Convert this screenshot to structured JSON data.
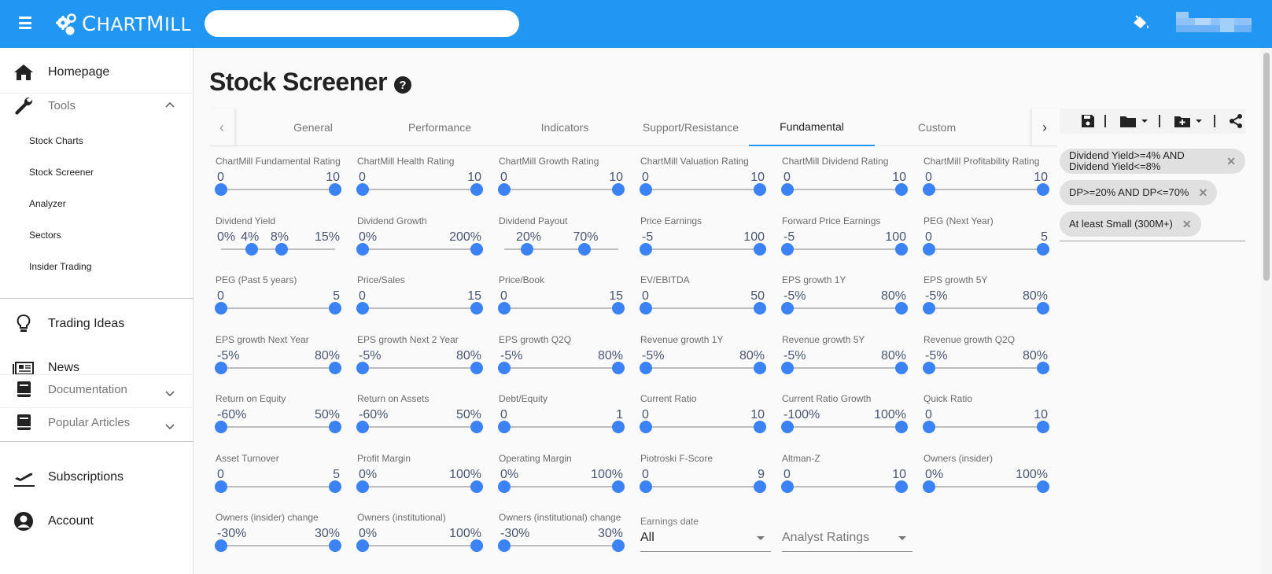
{
  "header": {
    "logo_text": "ChartMill",
    "search_placeholder": "",
    "paint_icon": "paint-bucket-icon",
    "user_name_blurred": true,
    "brand_color": "#2196f3"
  },
  "sidebar": {
    "main_items": [
      {
        "label": "Homepage",
        "icon": "home-icon"
      },
      {
        "label": "Tools",
        "icon": "wrench-icon",
        "expanded": true
      },
      {
        "label": "Trading Ideas",
        "icon": "lightbulb-icon"
      },
      {
        "label": "News",
        "icon": "newspaper-icon"
      },
      {
        "label": "Documentation",
        "icon": "book-icon",
        "expanded": false
      },
      {
        "label": "Popular Articles",
        "icon": "book-icon",
        "expanded": false
      },
      {
        "label": "Subscriptions",
        "icon": "plane-icon"
      },
      {
        "label": "Account",
        "icon": "account-icon"
      }
    ],
    "tools_subitems": [
      "Stock Charts",
      "Stock Screener",
      "Analyzer",
      "Sectors",
      "Insider Trading"
    ]
  },
  "page": {
    "title": "Stock Screener",
    "help_icon": "help-icon"
  },
  "tabs": {
    "items": [
      "General",
      "Performance",
      "Indicators",
      "Support/Resistance",
      "Fundamental",
      "Custom"
    ],
    "active": "Fundamental"
  },
  "toolbar": {
    "save": "save-icon",
    "open": "folder-icon",
    "new": "folder-plus-icon",
    "share": "share-icon"
  },
  "active_filters": [
    "Dividend Yield>=4% AND Dividend Yield<=8%",
    "DP>=20% AND DP<=70%",
    "At least Small (300M+)"
  ],
  "filters": [
    {
      "label": "ChartMill Fundamental Rating",
      "min": "0",
      "max": "10",
      "lo": 0,
      "hi": 1
    },
    {
      "label": "ChartMill Health Rating",
      "min": "0",
      "max": "10",
      "lo": 0,
      "hi": 1
    },
    {
      "label": "ChartMill Growth Rating",
      "min": "0",
      "max": "10",
      "lo": 0,
      "hi": 1
    },
    {
      "label": "ChartMill Valuation Rating",
      "min": "0",
      "max": "10",
      "lo": 0,
      "hi": 1
    },
    {
      "label": "ChartMill Dividend Rating",
      "min": "0",
      "max": "10",
      "lo": 0,
      "hi": 1
    },
    {
      "label": "ChartMill Profitability Rating",
      "min": "0",
      "max": "10",
      "lo": 0,
      "hi": 1
    },
    {
      "label": "Dividend Yield",
      "min": "0%",
      "max": "15%",
      "lo": 0.27,
      "hi": 0.53,
      "lo_label": "4%",
      "hi_label": "8%"
    },
    {
      "label": "Dividend Growth",
      "min": "0%",
      "max": "200%",
      "lo": 0,
      "hi": 1
    },
    {
      "label": "Dividend Payout",
      "min": "",
      "max": "",
      "lo": 0.2,
      "hi": 0.7,
      "lo_label": "20%",
      "hi_label": "70%"
    },
    {
      "label": "Price Earnings",
      "min": "-5",
      "max": "100",
      "lo": 0,
      "hi": 1
    },
    {
      "label": "Forward Price Earnings",
      "min": "-5",
      "max": "100",
      "lo": 0,
      "hi": 1
    },
    {
      "label": "PEG (Next Year)",
      "min": "0",
      "max": "5",
      "lo": 0,
      "hi": 1
    },
    {
      "label": "PEG (Past 5 years)",
      "min": "0",
      "max": "5",
      "lo": 0,
      "hi": 1
    },
    {
      "label": "Price/Sales",
      "min": "0",
      "max": "15",
      "lo": 0,
      "hi": 1
    },
    {
      "label": "Price/Book",
      "min": "0",
      "max": "15",
      "lo": 0,
      "hi": 1
    },
    {
      "label": "EV/EBITDA",
      "min": "0",
      "max": "50",
      "lo": 0,
      "hi": 1
    },
    {
      "label": "EPS growth 1Y",
      "min": "-5%",
      "max": "80%",
      "lo": 0,
      "hi": 1
    },
    {
      "label": "EPS growth 5Y",
      "min": "-5%",
      "max": "80%",
      "lo": 0,
      "hi": 1
    },
    {
      "label": "EPS growth Next Year",
      "min": "-5%",
      "max": "80%",
      "lo": 0,
      "hi": 1
    },
    {
      "label": "EPS growth Next 2 Year",
      "min": "-5%",
      "max": "80%",
      "lo": 0,
      "hi": 1
    },
    {
      "label": "EPS growth Q2Q",
      "min": "-5%",
      "max": "80%",
      "lo": 0,
      "hi": 1
    },
    {
      "label": "Revenue growth 1Y",
      "min": "-5%",
      "max": "80%",
      "lo": 0,
      "hi": 1
    },
    {
      "label": "Revenue growth 5Y",
      "min": "-5%",
      "max": "80%",
      "lo": 0,
      "hi": 1
    },
    {
      "label": "Revenue growth Q2Q",
      "min": "-5%",
      "max": "80%",
      "lo": 0,
      "hi": 1
    },
    {
      "label": "Return on Equity",
      "min": "-60%",
      "max": "50%",
      "lo": 0,
      "hi": 1
    },
    {
      "label": "Return on Assets",
      "min": "-60%",
      "max": "50%",
      "lo": 0,
      "hi": 1
    },
    {
      "label": "Debt/Equity",
      "min": "0",
      "max": "1",
      "lo": 0,
      "hi": 1
    },
    {
      "label": "Current Ratio",
      "min": "0",
      "max": "10",
      "lo": 0,
      "hi": 1
    },
    {
      "label": "Current Ratio Growth",
      "min": "-100%",
      "max": "100%",
      "lo": 0,
      "hi": 1
    },
    {
      "label": "Quick Ratio",
      "min": "0",
      "max": "10",
      "lo": 0,
      "hi": 1
    },
    {
      "label": "Asset Turnover",
      "min": "0",
      "max": "5",
      "lo": 0,
      "hi": 1
    },
    {
      "label": "Profit Margin",
      "min": "0%",
      "max": "100%",
      "lo": 0,
      "hi": 1
    },
    {
      "label": "Operating Margin",
      "min": "0%",
      "max": "100%",
      "lo": 0,
      "hi": 1
    },
    {
      "label": "Piotroski F-Score",
      "min": "0",
      "max": "9",
      "lo": 0,
      "hi": 1
    },
    {
      "label": "Altman-Z",
      "min": "0",
      "max": "10",
      "lo": 0,
      "hi": 1
    },
    {
      "label": "Owners (insider)",
      "min": "0%",
      "max": "100%",
      "lo": 0,
      "hi": 1
    },
    {
      "label": "Owners (insider) change",
      "min": "-30%",
      "max": "30%",
      "lo": 0,
      "hi": 1
    },
    {
      "label": "Owners (institutional)",
      "min": "0%",
      "max": "100%",
      "lo": 0,
      "hi": 1
    },
    {
      "label": "Owners (institutional) change",
      "min": "-30%",
      "max": "30%",
      "lo": 0,
      "hi": 1
    }
  ],
  "selects": {
    "earnings_date": {
      "label": "Earnings date",
      "value": "All"
    },
    "analyst_ratings": {
      "placeholder": "Analyst Ratings"
    }
  }
}
